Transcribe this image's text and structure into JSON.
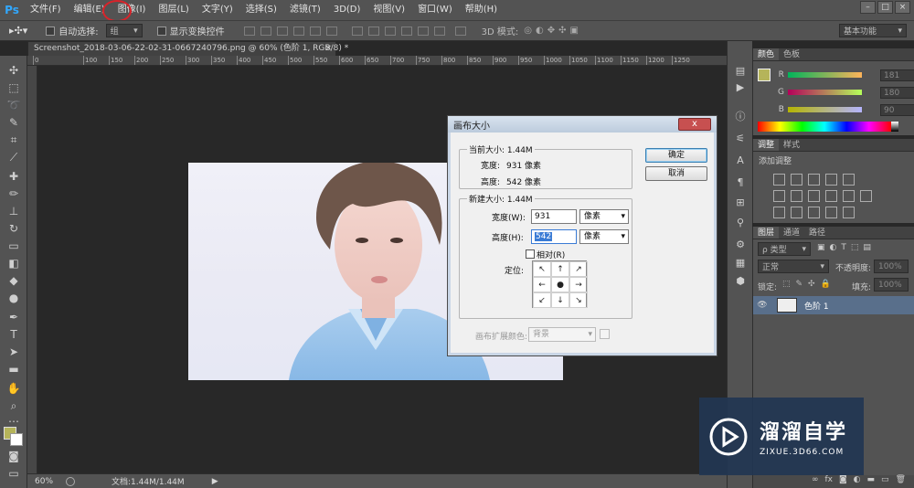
{
  "app": {
    "logo": "Ps"
  },
  "menu": [
    "文件(F)",
    "编辑(E)",
    "图像(I)",
    "图层(L)",
    "文字(Y)",
    "选择(S)",
    "滤镜(T)",
    "3D(D)",
    "视图(V)",
    "窗口(W)",
    "帮助(H)"
  ],
  "window_controls": {
    "minimize": "–",
    "restore": "□",
    "close": "×"
  },
  "options_bar": {
    "auto_select_label": "自动选择:",
    "auto_select_value": "组",
    "show_transform_label": "显示变换控件",
    "mode_3d_label": "3D 模式:",
    "workspace": "基本功能"
  },
  "document_tab": {
    "title": "Screenshot_2018-03-06-22-02-31-0667240796.png @ 60% (色阶 1, RGB/8) *",
    "close": "×"
  },
  "ruler_marks": [
    "0",
    "100",
    "150",
    "200",
    "250",
    "300",
    "350",
    "400",
    "450",
    "500",
    "550",
    "600",
    "650",
    "700",
    "750",
    "800",
    "850",
    "900",
    "950",
    "1000",
    "1050",
    "1100",
    "1150",
    "1200",
    "1250"
  ],
  "status": {
    "zoom": "60%",
    "doc_info": "文档:1.44M/1.44M"
  },
  "color_panel": {
    "tabs": [
      "颜色",
      "色板"
    ],
    "sliders": [
      {
        "label": "R",
        "value": "181",
        "color": "#b5b56f"
      },
      {
        "label": "G",
        "value": "180",
        "color": "#b5b56f"
      },
      {
        "label": "B",
        "value": "90",
        "color": "#b5b56f"
      }
    ],
    "foreground": "#b5b45a",
    "background": "#ffffff"
  },
  "adjustments_panel": {
    "tabs": [
      "调整",
      "样式"
    ],
    "title": "添加调整"
  },
  "layers_panel": {
    "tabs": [
      "图层",
      "通道",
      "路径"
    ],
    "filter_label": "ρ 类型",
    "blend_mode": "正常",
    "opacity_label": "不透明度:",
    "opacity_value": "100%",
    "lock_label": "锁定:",
    "fill_label": "填充:",
    "fill_value": "100%",
    "layers": [
      {
        "name": "色阶 1",
        "visible_icon": "eye-icon"
      }
    ],
    "footer_icons": [
      "link-icon",
      "fx-icon",
      "mask-icon",
      "adjustment-icon",
      "folder-icon",
      "new-layer-icon",
      "trash-icon"
    ]
  },
  "dialog": {
    "title": "画布大小",
    "close": "x",
    "current_size_label": "当前大小: 1.44M",
    "current_width_label": "宽度:",
    "current_width_value": "931 像素",
    "current_height_label": "高度:",
    "current_height_value": "542 像素",
    "new_size_label": "新建大小: 1.44M",
    "width_label": "宽度(W):",
    "width_value": "931",
    "width_unit": "像素",
    "height_label": "高度(H):",
    "height_value": "542",
    "height_unit": "像素",
    "relative_label": "相对(R)",
    "anchor_label": "定位:",
    "anchor_arrows": [
      "↖",
      "↑",
      "↗",
      "←",
      "●",
      "→",
      "↙",
      "↓",
      "↘"
    ],
    "ext_color_label": "画布扩展颜色:",
    "ext_color_value": "背景",
    "ok": "确定",
    "cancel": "取消"
  },
  "watermark": {
    "brand": "溜溜自学",
    "url": "ZIXUE.3D66.COM"
  }
}
